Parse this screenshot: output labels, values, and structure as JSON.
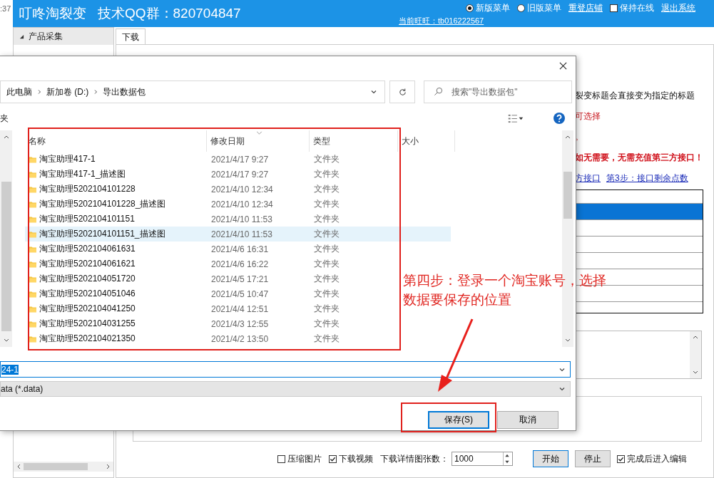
{
  "background_window": {
    "clock_fragment": ":37",
    "title": "叮咚淘裂变",
    "qq_group": "技术QQ群：820704847",
    "menu_versions": [
      {
        "label": "新版菜单",
        "selected": true
      },
      {
        "label": "旧版菜单",
        "selected": false
      }
    ],
    "relogin_link": "重登店铺",
    "keep_online": {
      "label": "保持在线",
      "checked": false
    },
    "logout_link": "退出系统",
    "current_account": "当前旺旺：tb016222567",
    "sidebar": {
      "group": "产品采集",
      "expanded": true
    },
    "tabs": [
      {
        "label": "下载",
        "selected": true
      }
    ],
    "notes": [
      {
        "text": "裂变标题会直接变为指定的标题",
        "kind": "plain"
      },
      {
        "text": "可选择",
        "kind": "warning"
      },
      {
        "text": "。",
        "kind": "warning"
      },
      {
        "text": "如无需要，无需充值第三方接口！",
        "kind": "alert"
      }
    ],
    "links": [
      "方接口",
      "第3步：接口剩余点数"
    ],
    "table_rows": [
      {
        "selected": false
      },
      {
        "selected": true
      },
      {
        "selected": false
      },
      {
        "selected": false
      },
      {
        "selected": false
      },
      {
        "selected": false
      },
      {
        "selected": false
      },
      {
        "selected": false
      }
    ],
    "options": {
      "compress_images": {
        "label": "压缩图片",
        "checked": false
      },
      "download_video": {
        "label": "下载视频",
        "checked": true
      },
      "detail_image_count": {
        "label": "下载详情图张数：",
        "value": "1000"
      },
      "buttons": [
        "开始",
        "停止"
      ],
      "edit_after": {
        "label": "完成后进入编辑",
        "checked": true
      }
    }
  },
  "save_dialog": {
    "breadcrumb": [
      "此电脑",
      "新加卷 (D:)",
      "导出数据包"
    ],
    "search": {
      "placeholder": "搜索\"导出数据包\""
    },
    "toolbar_fragment": "夹",
    "columns": [
      "名称",
      "修改日期",
      "类型",
      "大小"
    ],
    "files": [
      {
        "name": "淘宝助理417-1",
        "modified": "2021/4/17 9:27",
        "type": "文件夹",
        "hovered": false
      },
      {
        "name": "淘宝助理417-1_描述图",
        "modified": "2021/4/17 9:27",
        "type": "文件夹",
        "hovered": false
      },
      {
        "name": "淘宝助理5202104101228",
        "modified": "2021/4/10 12:34",
        "type": "文件夹",
        "hovered": false
      },
      {
        "name": "淘宝助理5202104101228_描述图",
        "modified": "2021/4/10 12:34",
        "type": "文件夹",
        "hovered": false
      },
      {
        "name": "淘宝助理5202104101151",
        "modified": "2021/4/10 11:53",
        "type": "文件夹",
        "hovered": false
      },
      {
        "name": "淘宝助理5202104101151_描述图",
        "modified": "2021/4/10 11:53",
        "type": "文件夹",
        "hovered": true
      },
      {
        "name": "淘宝助理5202104061631",
        "modified": "2021/4/6 16:31",
        "type": "文件夹",
        "hovered": false
      },
      {
        "name": "淘宝助理5202104061621",
        "modified": "2021/4/6 16:22",
        "type": "文件夹",
        "hovered": false
      },
      {
        "name": "淘宝助理5202104051720",
        "modified": "2021/4/5 17:21",
        "type": "文件夹",
        "hovered": false
      },
      {
        "name": "淘宝助理5202104051046",
        "modified": "2021/4/5 10:47",
        "type": "文件夹",
        "hovered": false
      },
      {
        "name": "淘宝助理5202104041250",
        "modified": "2021/4/4 12:51",
        "type": "文件夹",
        "hovered": false
      },
      {
        "name": "淘宝助理5202104031255",
        "modified": "2021/4/3 12:55",
        "type": "文件夹",
        "hovered": false
      },
      {
        "name": "淘宝助理5202104021350",
        "modified": "2021/4/2 13:50",
        "type": "文件夹",
        "hovered": false
      }
    ],
    "file_name": {
      "value": "24-1",
      "selected": true
    },
    "file_type": "ata (*.data)",
    "buttons": [
      "保存(S)",
      "取消"
    ]
  },
  "annotation": {
    "lines": [
      "第四步：登录一个淘宝账号，选择",
      "数据要保存的位置"
    ]
  }
}
